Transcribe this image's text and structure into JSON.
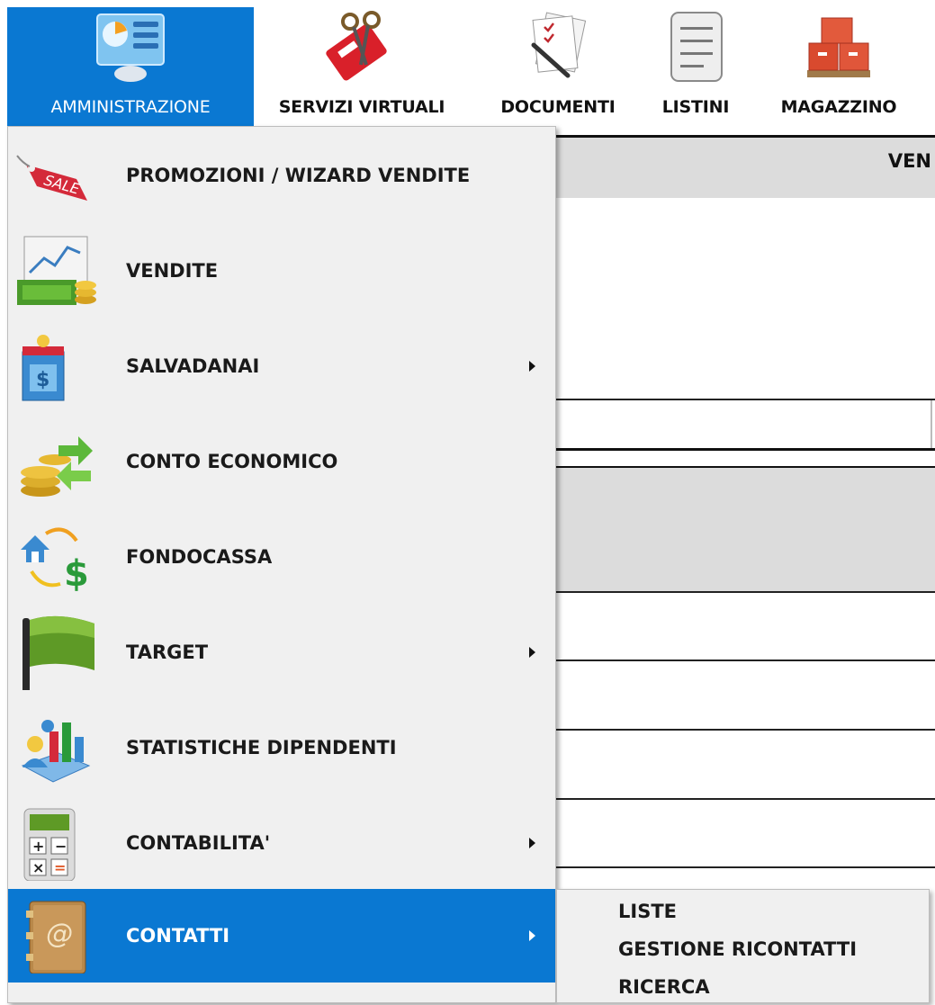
{
  "toolbar": {
    "items": [
      {
        "label": "AMMINISTRAZIONE",
        "icon": "admin-dashboard-icon"
      },
      {
        "label": "SERVIZI VIRTUALI",
        "icon": "scissors-card-icon"
      },
      {
        "label": "DOCUMENTI",
        "icon": "documents-pen-icon"
      },
      {
        "label": "LISTINI",
        "icon": "list-notepad-icon"
      },
      {
        "label": "MAGAZZINO",
        "icon": "warehouse-boxes-icon"
      }
    ]
  },
  "background": {
    "header_text": "VEN"
  },
  "menu": {
    "items": [
      {
        "label": "PROMOZIONI / WIZARD VENDITE",
        "icon": "sale-tag-icon",
        "has_submenu": false
      },
      {
        "label": "VENDITE",
        "icon": "sales-chart-money-icon",
        "has_submenu": false
      },
      {
        "label": "SALVADANAI",
        "icon": "piggy-bank-box-icon",
        "has_submenu": true
      },
      {
        "label": "CONTO ECONOMICO",
        "icon": "coins-arrows-icon",
        "has_submenu": false
      },
      {
        "label": "FONDOCASSA",
        "icon": "house-dollar-exchange-icon",
        "has_submenu": false
      },
      {
        "label": "TARGET",
        "icon": "green-flag-icon",
        "has_submenu": true
      },
      {
        "label": "STATISTICHE DIPENDENTI",
        "icon": "employee-stats-icon",
        "has_submenu": false
      },
      {
        "label": "CONTABILITA'",
        "icon": "calculator-icon",
        "has_submenu": true
      },
      {
        "label": "CONTATTI",
        "icon": "address-book-icon",
        "has_submenu": true
      }
    ],
    "selected_color": "#0a78d2"
  },
  "submenu": {
    "items": [
      {
        "label": "LISTE"
      },
      {
        "label": "GESTIONE RICONTATTI"
      },
      {
        "label": "RICERCA"
      }
    ]
  }
}
